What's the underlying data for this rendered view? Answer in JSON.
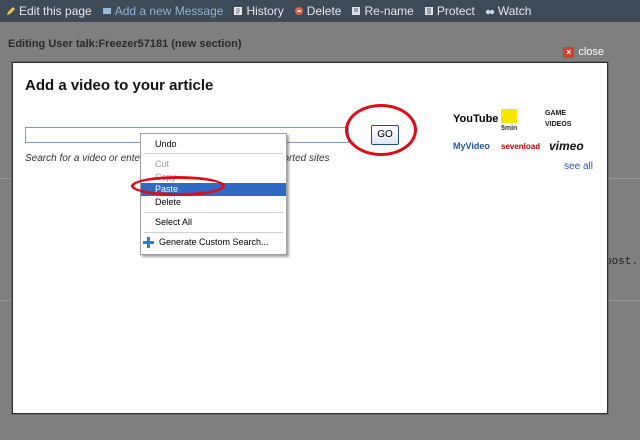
{
  "toolbar": {
    "items": [
      {
        "label": "Edit this page"
      },
      {
        "label": "Add a new Message"
      },
      {
        "label": "History"
      },
      {
        "label": "Delete"
      },
      {
        "label": "Re-name"
      },
      {
        "label": "Protect"
      },
      {
        "label": "Watch"
      }
    ]
  },
  "background": {
    "header": "Editing User talk:Freezer57181 (new section)",
    "right_text": "post."
  },
  "modal": {
    "close_label": "close",
    "title": "Add a video to your article",
    "input_value": "",
    "go_label": "GO",
    "helper_left": "Search for a video or enter",
    "helper_right": "orted sites",
    "logos": [
      "YouTube",
      "5min",
      "GAME VIDEOS",
      "MyVideo",
      "sevenload",
      "vimeo"
    ],
    "see_all": "see all"
  },
  "context_menu": {
    "items": [
      {
        "label": "Undo",
        "state": "enabled"
      },
      {
        "label": "Cut",
        "state": "disabled"
      },
      {
        "label": "Copy",
        "state": "disabled"
      },
      {
        "label": "Paste",
        "state": "selected"
      },
      {
        "label": "Delete",
        "state": "enabled"
      },
      {
        "label": "Select All",
        "state": "enabled"
      },
      {
        "label": "Generate Custom Search...",
        "state": "enabled"
      }
    ]
  },
  "colors": {
    "annotation": "#e00b16",
    "selection": "#316ac5",
    "toolbar": "#3f4a57"
  }
}
